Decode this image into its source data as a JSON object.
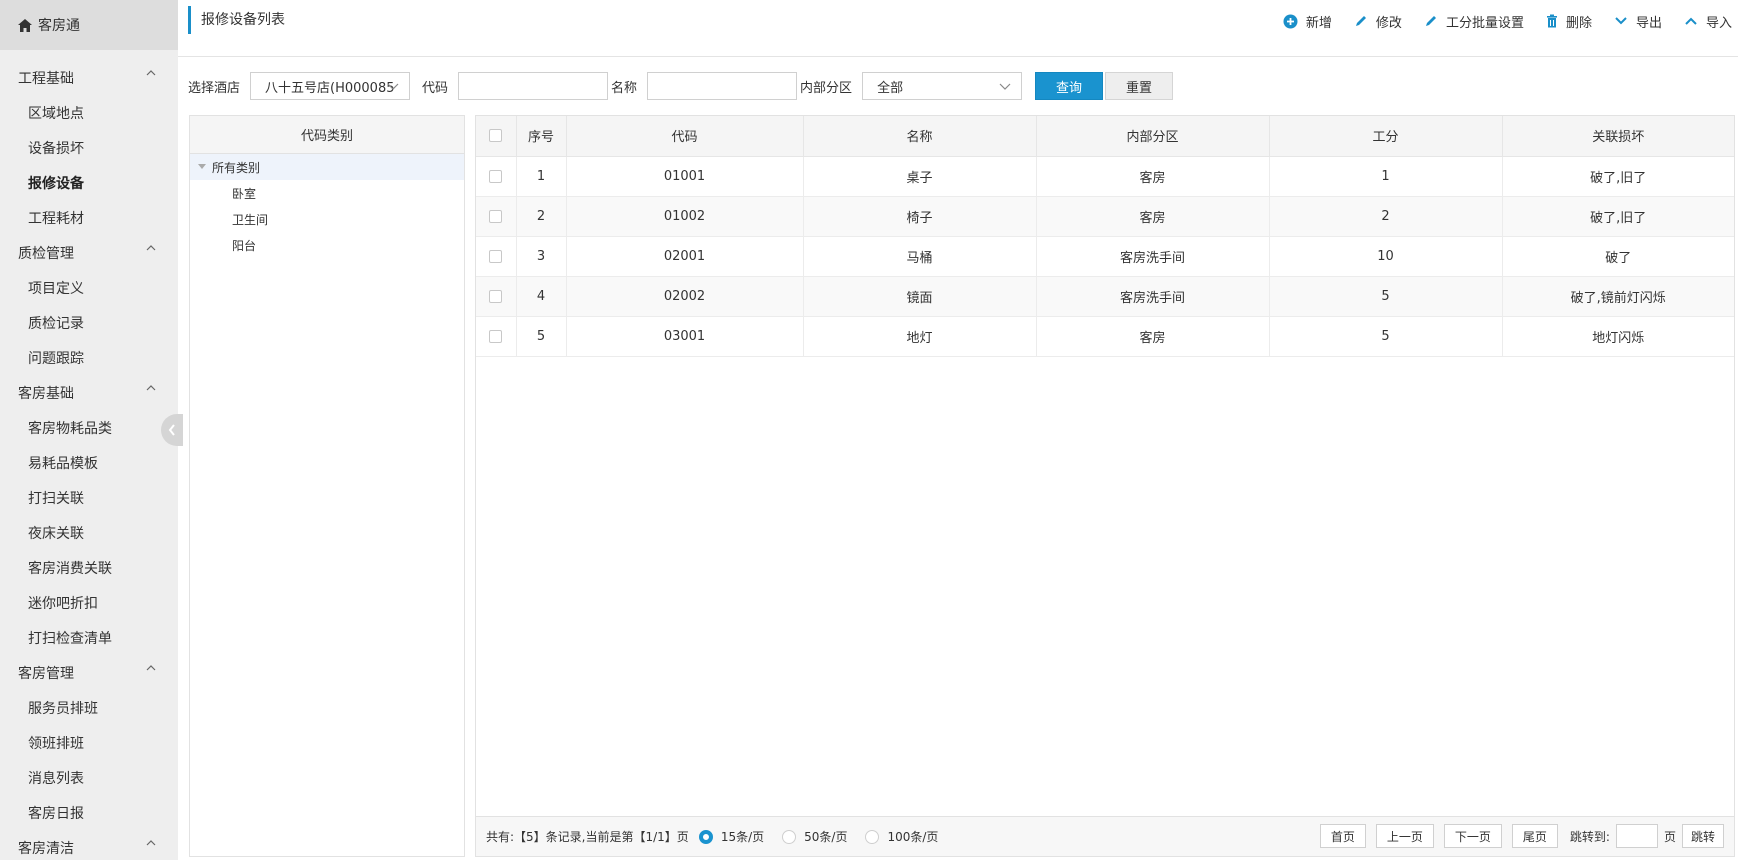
{
  "brand": {
    "title": "客房通"
  },
  "sidebar": {
    "groups": [
      {
        "label": "工程基础",
        "items": [
          "区域地点",
          "设备损坏",
          "报修设备",
          "工程耗材"
        ]
      },
      {
        "label": "质检管理",
        "items": [
          "项目定义",
          "质检记录",
          "问题跟踪"
        ]
      },
      {
        "label": "客房基础",
        "items": [
          "客房物耗品类",
          "易耗品模板",
          "打扫关联",
          "夜床关联",
          "客房消费关联",
          "迷你吧折扣",
          "打扫检查清单"
        ]
      },
      {
        "label": "客房管理",
        "items": [
          "服务员排班",
          "领班排班",
          "消息列表",
          "客房日报"
        ]
      },
      {
        "label": "客房清洁",
        "items": []
      }
    ],
    "active_item": "报修设备"
  },
  "header": {
    "title": "报修设备列表",
    "toolbar": {
      "add": "新增",
      "edit": "修改",
      "batch": "工分批量设置",
      "delete": "删除",
      "export": "导出",
      "import": "导入"
    }
  },
  "filters": {
    "hotel_label": "选择酒店",
    "hotel_value": "八十五号店(H000085",
    "code_label": "代码",
    "code_value": "",
    "name_label": "名称",
    "name_value": "",
    "zone_label": "内部分区",
    "zone_value": "全部",
    "query_button": "查询",
    "reset_button": "重置"
  },
  "tree": {
    "header": "代码类别",
    "root": "所有类别",
    "nodes": [
      "卧室",
      "卫生间",
      "阳台"
    ]
  },
  "table": {
    "columns": [
      "序号",
      "代码",
      "名称",
      "内部分区",
      "工分",
      "关联损坏"
    ],
    "rows": [
      [
        "1",
        "01001",
        "桌子",
        "客房",
        "1",
        "破了,旧了"
      ],
      [
        "2",
        "01002",
        "椅子",
        "客房",
        "2",
        "破了,旧了"
      ],
      [
        "3",
        "02001",
        "马桶",
        "客房洗手间",
        "10",
        "破了"
      ],
      [
        "4",
        "02002",
        "镜面",
        "客房洗手间",
        "5",
        "破了,镜前灯闪烁"
      ],
      [
        "5",
        "03001",
        "地灯",
        "客房",
        "5",
        "地灯闪烁"
      ]
    ]
  },
  "pager": {
    "summary": "共有:【5】条记录,当前是第【1/1】页",
    "size_options": [
      "15条/页",
      "50条/页",
      "100条/页"
    ],
    "selected_size": "15条/页",
    "first": "首页",
    "prev": "上一页",
    "next": "下一页",
    "last": "尾页",
    "jump_label": "跳转到:",
    "page_unit": "页",
    "jump_button": "跳转"
  },
  "colors": {
    "accent": "#1a93cf",
    "sidebar_bg": "#eeeeee"
  },
  "icons": [
    "home-icon",
    "chevron-up-icon",
    "plus-circle-icon",
    "pencil-icon",
    "trash-icon",
    "chevron-down-icon",
    "caret-down-icon",
    "collapse-arrow-icon"
  ]
}
